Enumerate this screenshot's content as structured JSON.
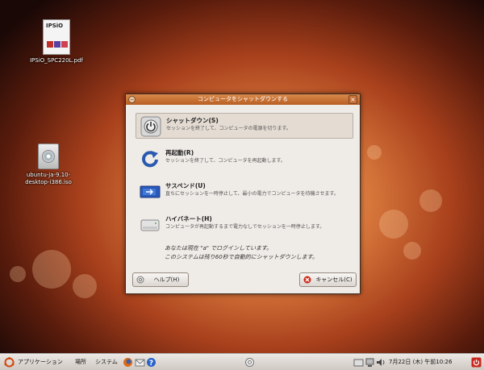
{
  "desktop": {
    "icons": [
      {
        "label": "IPSiO_SPC220L.pdf",
        "thumb_text": "IPSiO"
      },
      {
        "label_line1": "ubuntu-ja-9.10-",
        "label_line2": "desktop-i386.iso"
      }
    ]
  },
  "dialog": {
    "title": "コンピュータをシャットダウンする",
    "options": [
      {
        "title": "シャットダウン(S)",
        "desc": "セッションを終了して、コンピュータの電源を切ります。",
        "icon": "power-icon"
      },
      {
        "title": "再起動(R)",
        "desc": "セッションを終了して、コンピュータを再起動します。",
        "icon": "restart-icon"
      },
      {
        "title": "サスペンド(U)",
        "desc": "直ちにセッションを一時停止して、最小の電力でコンピュータを待機させます。",
        "icon": "suspend-icon"
      },
      {
        "title": "ハイバネート(H)",
        "desc": "コンピュータが再起動するまで電力なしでセッションを一時停止します。",
        "icon": "hibernate-icon"
      }
    ],
    "notice_line1": "あなたは現在 \"a\" でログインしています。",
    "notice_line2": "このシステムは残り60秒で自動的にシャットダウンします。",
    "help_label": "ヘルプ(H)",
    "cancel_label": "キャンセル(C)"
  },
  "panel": {
    "applications": "アプリケーション",
    "places": "場所",
    "system": "システム",
    "clock": "7月22日 (木) 午前10:26"
  },
  "colors": {
    "titlebar": "#c8702f",
    "panel": "#dcd6d0",
    "accent": "#e07020"
  }
}
